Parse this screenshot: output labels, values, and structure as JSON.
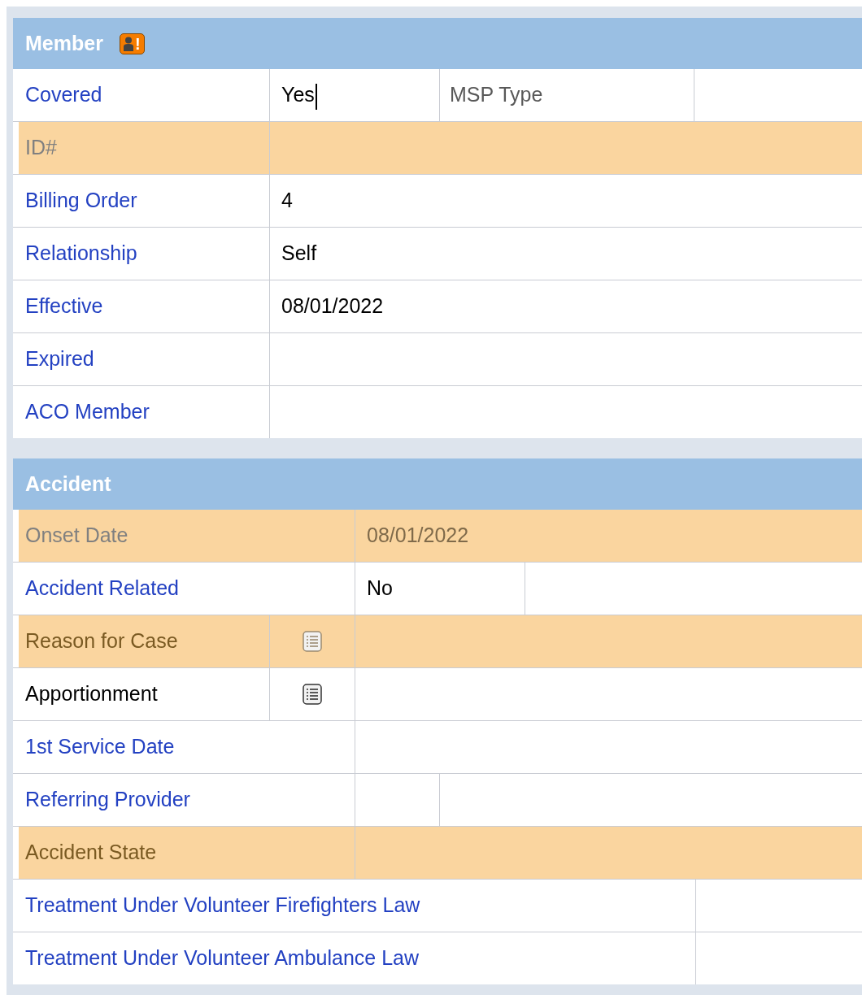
{
  "sections": [
    {
      "title": "Member",
      "kind": "member",
      "badge": "!",
      "rows": [
        {
          "label": "Covered",
          "kind": "pair",
          "link": true,
          "required": false,
          "disabled": false,
          "value": "Yes",
          "cursor": true,
          "second_label": "MSP Type"
        },
        {
          "label": "ID#",
          "kind": "single",
          "link": false,
          "required": true,
          "disabled": true
        },
        {
          "label": "Billing Order",
          "kind": "single",
          "link": true,
          "required": false,
          "disabled": false,
          "value": "4"
        },
        {
          "label": "Relationship",
          "kind": "single",
          "link": true,
          "required": false,
          "disabled": false,
          "value": "Self"
        },
        {
          "label": "Effective",
          "kind": "single",
          "link": true,
          "required": false,
          "disabled": false,
          "value": "08/01/2022"
        },
        {
          "label": "Expired",
          "kind": "single",
          "link": true,
          "required": false,
          "disabled": false
        },
        {
          "label": "ACO Member",
          "kind": "single",
          "link": true,
          "required": false,
          "disabled": false
        }
      ]
    },
    {
      "title": "Accident",
      "kind": "accident",
      "rows": [
        {
          "label": "Onset Date",
          "kind": "single",
          "link": false,
          "required": true,
          "disabled": true,
          "value": "08/01/2022"
        },
        {
          "label": "Accident Related",
          "kind": "pair",
          "link": true,
          "required": false,
          "disabled": false,
          "value": "No"
        },
        {
          "label": "Reason for Case",
          "kind": "icon",
          "link": false,
          "required": true,
          "disabled": false
        },
        {
          "label": "Apportionment",
          "kind": "icon",
          "link": false,
          "required": false,
          "disabled": false
        },
        {
          "label": "1st Service Date",
          "kind": "single",
          "link": true,
          "required": false,
          "disabled": false
        },
        {
          "label": "Referring Provider",
          "kind": "narrow",
          "link": true,
          "required": false,
          "disabled": false
        },
        {
          "label": "Accident State",
          "kind": "single",
          "link": false,
          "required": true,
          "disabled": false
        },
        {
          "label": "Treatment Under Volunteer Firefighters Law",
          "kind": "wide",
          "link": true,
          "required": false,
          "disabled": false
        },
        {
          "label": "Treatment Under Volunteer Ambulance Law",
          "kind": "wide",
          "link": true,
          "required": false,
          "disabled": false
        }
      ]
    }
  ]
}
